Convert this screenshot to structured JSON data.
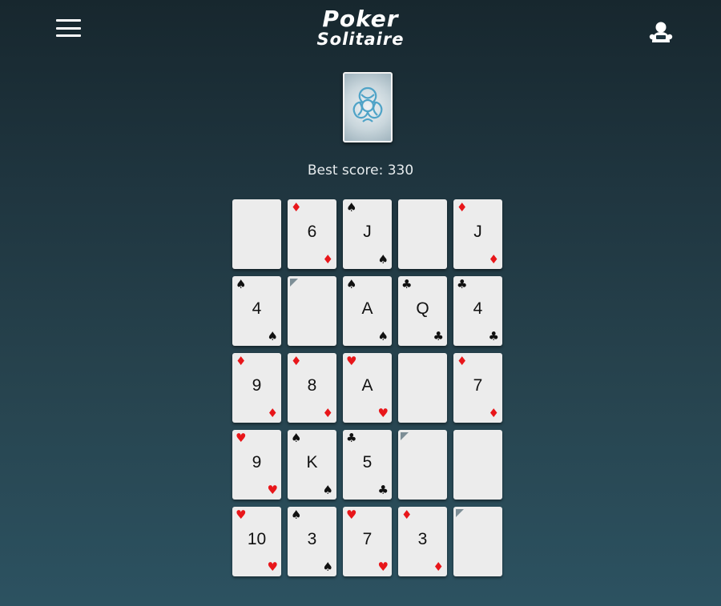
{
  "header": {
    "title_line1": "Poker",
    "title_line2": "Solitaire",
    "menu_icon": "hamburger-menu-icon",
    "profile_icon": "player-profile-icon"
  },
  "deck": {
    "icon": "card-back-knot-icon"
  },
  "best_score": {
    "text": "Best score: 330"
  },
  "suits": {
    "spades": "♠",
    "clubs": "♣",
    "hearts": "♥",
    "diamonds": "♦"
  },
  "colors": {
    "red_suit": "#e8161a",
    "black_suit": "#111111",
    "fold_marker": "#7d8e96"
  },
  "board": [
    [
      {
        "state": "empty"
      },
      {
        "rank": "6",
        "suit": "diamonds"
      },
      {
        "rank": "J",
        "suit": "spades"
      },
      {
        "state": "empty"
      },
      {
        "rank": "J",
        "suit": "diamonds"
      }
    ],
    [
      {
        "rank": "4",
        "suit": "spades"
      },
      {
        "state": "marked"
      },
      {
        "rank": "A",
        "suit": "spades"
      },
      {
        "rank": "Q",
        "suit": "clubs"
      },
      {
        "rank": "4",
        "suit": "clubs"
      }
    ],
    [
      {
        "rank": "9",
        "suit": "diamonds"
      },
      {
        "rank": "8",
        "suit": "diamonds"
      },
      {
        "rank": "A",
        "suit": "hearts"
      },
      {
        "state": "empty"
      },
      {
        "rank": "7",
        "suit": "diamonds"
      }
    ],
    [
      {
        "rank": "9",
        "suit": "hearts"
      },
      {
        "rank": "K",
        "suit": "spades"
      },
      {
        "rank": "5",
        "suit": "clubs"
      },
      {
        "state": "marked"
      },
      {
        "state": "empty"
      }
    ],
    [
      {
        "rank": "10",
        "suit": "hearts"
      },
      {
        "rank": "3",
        "suit": "spades"
      },
      {
        "rank": "7",
        "suit": "hearts"
      },
      {
        "rank": "3",
        "suit": "diamonds"
      },
      {
        "state": "marked"
      }
    ]
  ]
}
